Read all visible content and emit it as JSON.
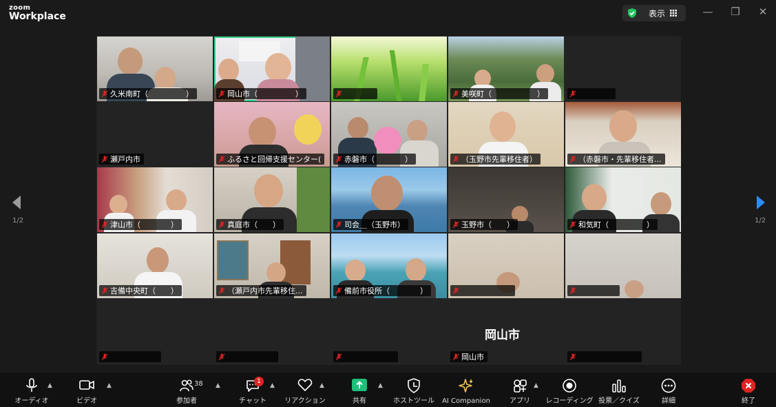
{
  "window": {
    "logo_small": "zoom",
    "logo_big": "Workplace",
    "view_label": "表示"
  },
  "gallery": {
    "tiles": [
      {
        "name": "久米南町（　　　　　）"
      },
      {
        "name": "岡山市（　　　　　）"
      },
      {
        "name": ""
      },
      {
        "name": "美咲町（　　　　　　）"
      },
      {
        "name": ""
      },
      {
        "name": "瀬戸内市"
      },
      {
        "name": "ふるさと回帰支援センター("
      },
      {
        "name": "赤磐市（　　　　）"
      },
      {
        "name": "（玉野市先輩移住者）"
      },
      {
        "name": "（赤磐市・先輩移住者..."
      },
      {
        "name": "津山市（　　　　）"
      },
      {
        "name": "真庭市（　　）"
      },
      {
        "name": "司会＿（玉野市）"
      },
      {
        "name": "玉野市（　　）"
      },
      {
        "name": "和気町（　　　　　）"
      },
      {
        "name": "吉備中央町（　　）"
      },
      {
        "name": "（瀬戸内市先輩移住..."
      },
      {
        "name": "備前市役所（　　　　）"
      },
      {
        "name": ""
      },
      {
        "name": ""
      },
      {
        "name": ""
      },
      {
        "name": ""
      },
      {
        "name": ""
      },
      {
        "name": "岡山市"
      },
      {
        "name": ""
      }
    ],
    "big_name": "岡山市",
    "page_left": "1/2",
    "page_right": "1/2"
  },
  "toolbar": {
    "audio": "オーディオ",
    "video": "ビデオ",
    "participants": "参加者",
    "participants_count": "38",
    "chat": "チャット",
    "chat_badge": "1",
    "reactions": "リアクション",
    "share": "共有",
    "host_tools": "ホストツール",
    "ai_companion": "AI Companion",
    "apps": "アプリ",
    "recording": "レコーディング",
    "polls": "投票／クイズ",
    "more": "詳細",
    "end": "終了"
  },
  "colors": {
    "active_speaker": "#2ed08b",
    "share_green": "#1ec07a",
    "end_red": "#e02424",
    "page_arrow": "#2d8cff",
    "mute_red": "#e02424"
  }
}
